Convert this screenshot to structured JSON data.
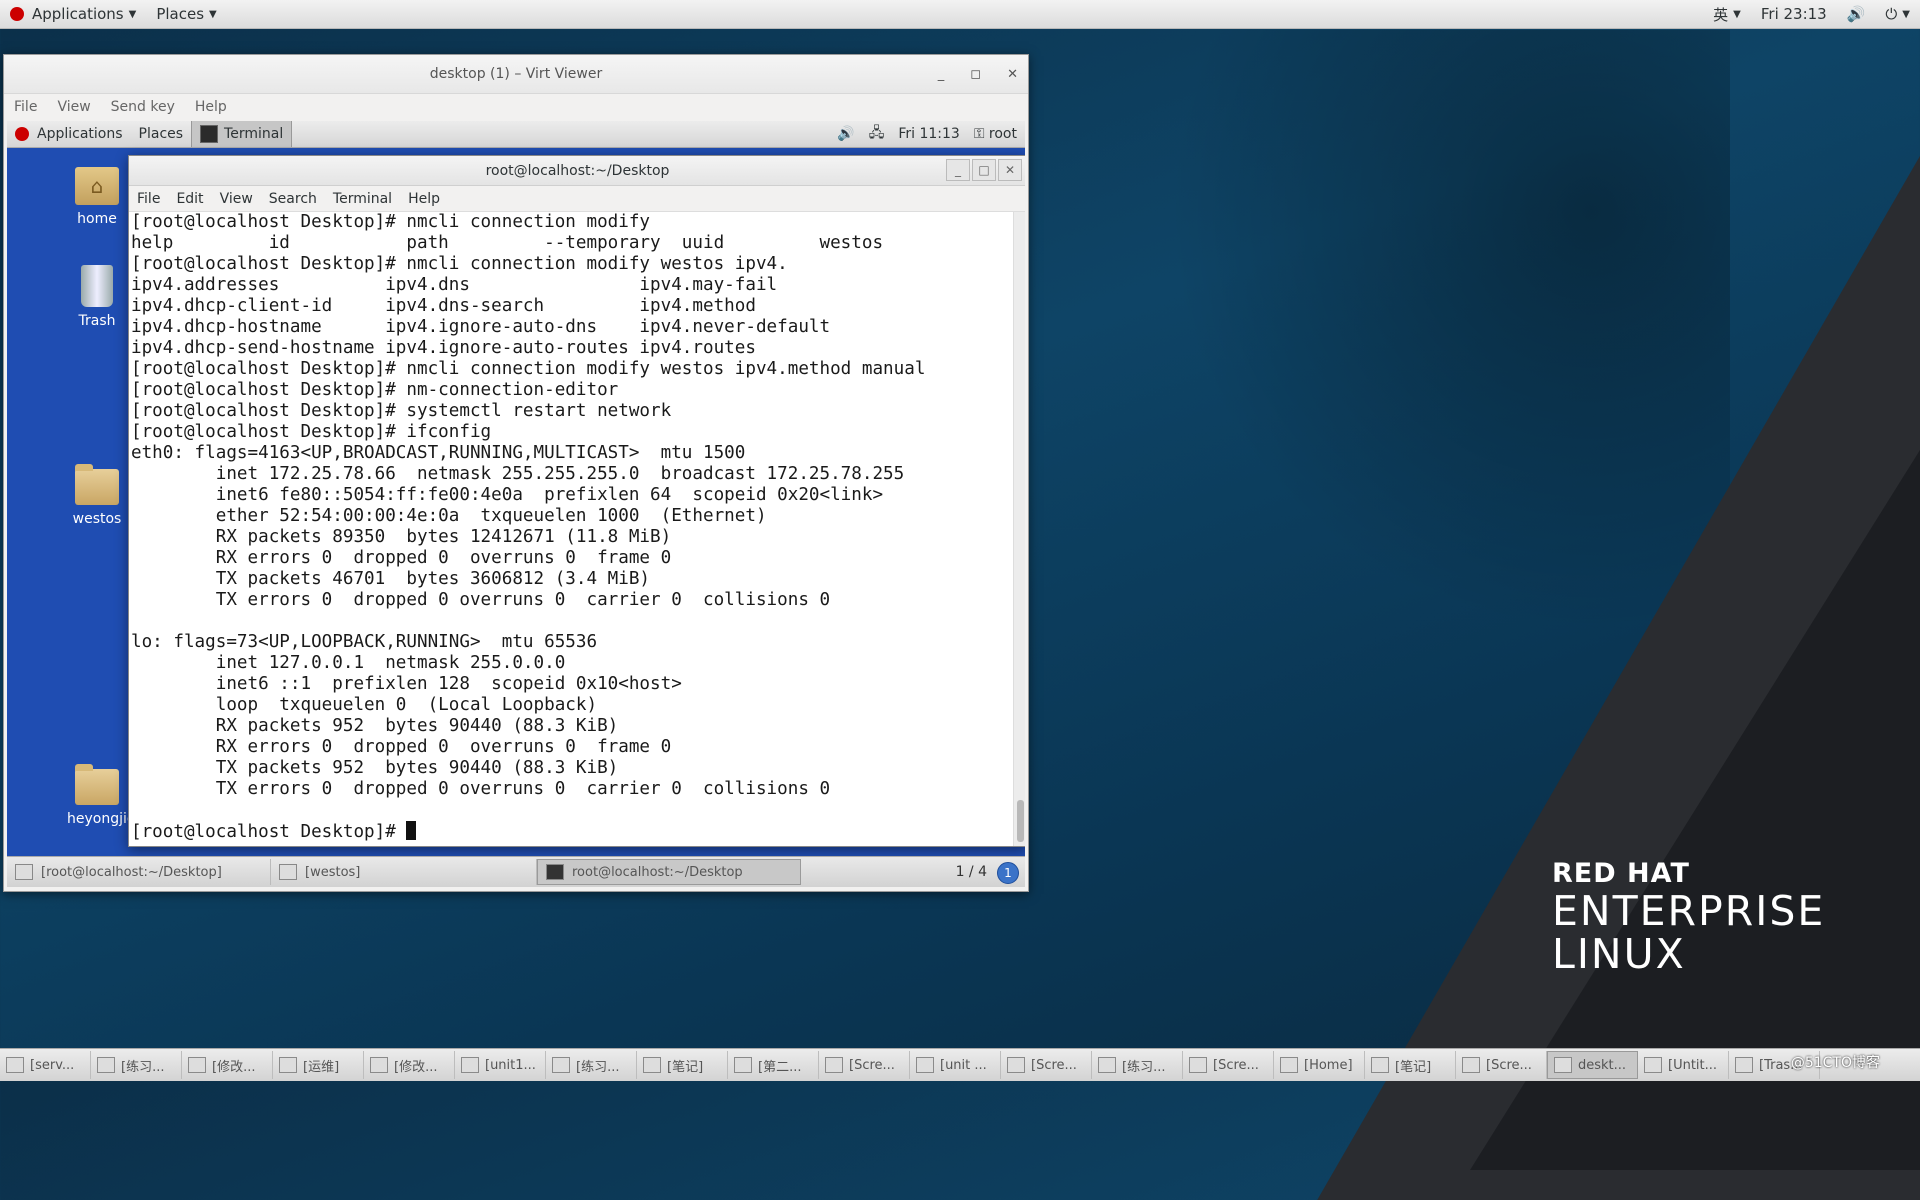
{
  "host_topbar": {
    "applications": "Applications",
    "places": "Places",
    "input_method": "英",
    "clock": "Fri 23:13"
  },
  "virt_viewer": {
    "title": "desktop (1) – Virt Viewer",
    "menu": [
      "File",
      "View",
      "Send key",
      "Help"
    ]
  },
  "guest_topbar": {
    "applications": "Applications",
    "places": "Places",
    "terminal": "Terminal",
    "clock": "Fri 11:13",
    "user": "root"
  },
  "guest_desktop_icons": {
    "home": "home",
    "trash": "Trash",
    "westos": "westos",
    "heyongjie": "heyongjie"
  },
  "terminal": {
    "title": "root@localhost:~/Desktop",
    "menu": [
      "File",
      "Edit",
      "View",
      "Search",
      "Terminal",
      "Help"
    ],
    "lines": [
      "[root@localhost Desktop]# nmcli connection modify",
      "help         id           path         --temporary  uuid         westos",
      "[root@localhost Desktop]# nmcli connection modify westos ipv4.",
      "ipv4.addresses          ipv4.dns                ipv4.may-fail",
      "ipv4.dhcp-client-id     ipv4.dns-search         ipv4.method",
      "ipv4.dhcp-hostname      ipv4.ignore-auto-dns    ipv4.never-default",
      "ipv4.dhcp-send-hostname ipv4.ignore-auto-routes ipv4.routes",
      "[root@localhost Desktop]# nmcli connection modify westos ipv4.method manual",
      "[root@localhost Desktop]# nm-connection-editor",
      "[root@localhost Desktop]# systemctl restart network",
      "[root@localhost Desktop]# ifconfig",
      "eth0: flags=4163<UP,BROADCAST,RUNNING,MULTICAST>  mtu 1500",
      "        inet 172.25.78.66  netmask 255.255.255.0  broadcast 172.25.78.255",
      "        inet6 fe80::5054:ff:fe00:4e0a  prefixlen 64  scopeid 0x20<link>",
      "        ether 52:54:00:00:4e:0a  txqueuelen 1000  (Ethernet)",
      "        RX packets 89350  bytes 12412671 (11.8 MiB)",
      "        RX errors 0  dropped 0  overruns 0  frame 0",
      "        TX packets 46701  bytes 3606812 (3.4 MiB)",
      "        TX errors 0  dropped 0 overruns 0  carrier 0  collisions 0",
      "",
      "lo: flags=73<UP,LOOPBACK,RUNNING>  mtu 65536",
      "        inet 127.0.0.1  netmask 255.0.0.0",
      "        inet6 ::1  prefixlen 128  scopeid 0x10<host>",
      "        loop  txqueuelen 0  (Local Loopback)",
      "        RX packets 952  bytes 90440 (88.3 KiB)",
      "        RX errors 0  dropped 0  overruns 0  frame 0",
      "        TX packets 952  bytes 90440 (88.3 KiB)",
      "        TX errors 0  dropped 0 overruns 0  carrier 0  collisions 0",
      ""
    ],
    "prompt": "[root@localhost Desktop]# "
  },
  "guest_taskbar": {
    "items": [
      "[root@localhost:~/Desktop]",
      "[westos]",
      "root@localhost:~/Desktop"
    ],
    "page": "1 / 4",
    "notify": "1"
  },
  "redhat_logo": {
    "line1": "RED HAT",
    "line2": "ENTERPRISE",
    "line3": "LINUX"
  },
  "host_taskbar": {
    "items": [
      "[serv...",
      "[练习...",
      "[修改...",
      "[运维]",
      "[修改...",
      "[unit1...",
      "[练习...",
      "[笔记]",
      "[第二...",
      "[Scre...",
      "[unit ...",
      "[Scre...",
      "[练习...",
      "[Scre...",
      "[Home]",
      "[笔记]",
      "[Scre...",
      "deskt...",
      "[Untit...",
      "[Tras..."
    ],
    "watermark": "@51CTO博客"
  }
}
